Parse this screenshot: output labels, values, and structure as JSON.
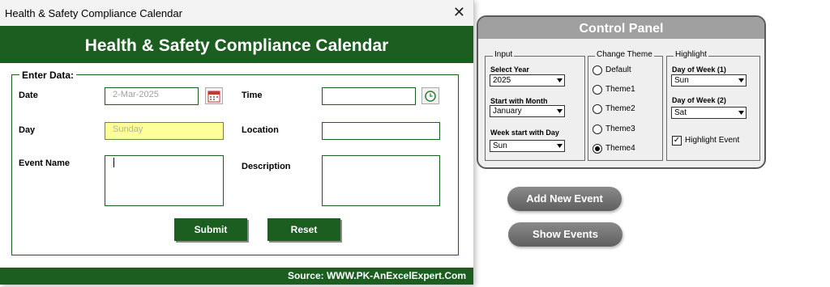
{
  "dialog": {
    "title": "Health & Safety Compliance Calendar",
    "banner": "Health & Safety Compliance Calendar",
    "frame_label": "Enter Data:",
    "fields": {
      "date_label": "Date",
      "date_value": "2-Mar-2025",
      "day_label": "Day",
      "day_value": "Sunday",
      "event_name_label": "Event Name",
      "event_name_value": "",
      "time_label": "Time",
      "time_value": "",
      "location_label": "Location",
      "location_value": "",
      "description_label": "Description",
      "description_value": ""
    },
    "submit_label": "Submit",
    "reset_label": "Reset",
    "footer": "Source: WWW.PK-AnExcelExpert.Com"
  },
  "control_panel": {
    "title": "Control Panel",
    "input": {
      "label": "Input",
      "year_label": "Select Year",
      "year_value": "2025",
      "month_label": "Start with Month",
      "month_value": "January",
      "week_label": "Week start with Day",
      "week_value": "Sun"
    },
    "theme": {
      "label": "Change Theme",
      "options": [
        "Default",
        "Theme1",
        "Theme2",
        "Theme3",
        "Theme4"
      ],
      "selected_index": 4
    },
    "highlight": {
      "label": "Highlight",
      "dow1_label": "Day of Week (1)",
      "dow1_value": "Sun",
      "dow2_label": "Day of Week (2)",
      "dow2_value": "Sat",
      "event_label": "Highlight Event",
      "event_checked": true
    }
  },
  "buttons": {
    "add_event": "Add New Event",
    "show_events": "Show Events"
  },
  "colors": {
    "green": "#1b5e20",
    "grey_header": "#a0a0a0",
    "day_field": "#ffff99"
  }
}
